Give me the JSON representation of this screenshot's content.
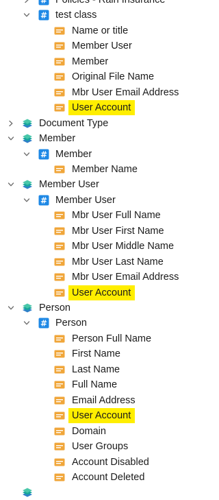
{
  "tree": [
    {
      "label": "Policies - Rain Insurance",
      "icon": "hash-icon",
      "indent": 1,
      "chevron": "right",
      "highlight": false
    },
    {
      "label": "test class",
      "icon": "hash-icon",
      "indent": 1,
      "chevron": "down",
      "highlight": false
    },
    {
      "label": "Name or title",
      "icon": "field-icon",
      "indent": 2,
      "chevron": "none",
      "highlight": false
    },
    {
      "label": "Member User",
      "icon": "field-icon",
      "indent": 2,
      "chevron": "none",
      "highlight": false
    },
    {
      "label": "Member",
      "icon": "field-icon",
      "indent": 2,
      "chevron": "none",
      "highlight": false
    },
    {
      "label": "Original File Name",
      "icon": "field-icon",
      "indent": 2,
      "chevron": "none",
      "highlight": false
    },
    {
      "label": "Mbr User Email Address",
      "icon": "field-icon",
      "indent": 2,
      "chevron": "none",
      "highlight": false
    },
    {
      "label": "User Account",
      "icon": "field-icon",
      "indent": 2,
      "chevron": "none",
      "highlight": true
    },
    {
      "label": "Document Type",
      "icon": "layers-icon",
      "indent": 0,
      "chevron": "right",
      "highlight": false
    },
    {
      "label": "Member",
      "icon": "layers-icon",
      "indent": 0,
      "chevron": "down",
      "highlight": false
    },
    {
      "label": "Member",
      "icon": "hash-icon",
      "indent": 1,
      "chevron": "down",
      "highlight": false
    },
    {
      "label": "Member Name",
      "icon": "field-icon",
      "indent": 2,
      "chevron": "none",
      "highlight": false
    },
    {
      "label": "Member User",
      "icon": "layers-icon",
      "indent": 0,
      "chevron": "down",
      "highlight": false
    },
    {
      "label": "Member User",
      "icon": "hash-icon",
      "indent": 1,
      "chevron": "down",
      "highlight": false
    },
    {
      "label": "Mbr User Full Name",
      "icon": "field-icon",
      "indent": 2,
      "chevron": "none",
      "highlight": false
    },
    {
      "label": "Mbr User First Name",
      "icon": "field-icon",
      "indent": 2,
      "chevron": "none",
      "highlight": false
    },
    {
      "label": "Mbr User Middle Name",
      "icon": "field-icon",
      "indent": 2,
      "chevron": "none",
      "highlight": false
    },
    {
      "label": "Mbr User Last Name",
      "icon": "field-icon",
      "indent": 2,
      "chevron": "none",
      "highlight": false
    },
    {
      "label": "Mbr User Email Address",
      "icon": "field-icon",
      "indent": 2,
      "chevron": "none",
      "highlight": false
    },
    {
      "label": "User Account",
      "icon": "field-icon",
      "indent": 2,
      "chevron": "none",
      "highlight": true
    },
    {
      "label": "Person",
      "icon": "layers-icon",
      "indent": 0,
      "chevron": "down",
      "highlight": false
    },
    {
      "label": "Person",
      "icon": "hash-icon",
      "indent": 1,
      "chevron": "down",
      "highlight": false
    },
    {
      "label": "Person Full Name",
      "icon": "field-icon",
      "indent": 2,
      "chevron": "none",
      "highlight": false
    },
    {
      "label": "First Name",
      "icon": "field-icon",
      "indent": 2,
      "chevron": "none",
      "highlight": false
    },
    {
      "label": "Last Name",
      "icon": "field-icon",
      "indent": 2,
      "chevron": "none",
      "highlight": false
    },
    {
      "label": "Full Name",
      "icon": "field-icon",
      "indent": 2,
      "chevron": "none",
      "highlight": false
    },
    {
      "label": "Email Address",
      "icon": "field-icon",
      "indent": 2,
      "chevron": "none",
      "highlight": false
    },
    {
      "label": "User Account",
      "icon": "field-icon",
      "indent": 2,
      "chevron": "none",
      "highlight": true
    },
    {
      "label": "Domain",
      "icon": "field-icon",
      "indent": 2,
      "chevron": "none",
      "highlight": false
    },
    {
      "label": "User Groups",
      "icon": "field-icon",
      "indent": 2,
      "chevron": "none",
      "highlight": false
    },
    {
      "label": "Account Disabled",
      "icon": "field-icon",
      "indent": 2,
      "chevron": "none",
      "highlight": false
    },
    {
      "label": "Account Deleted",
      "icon": "field-icon",
      "indent": 2,
      "chevron": "none",
      "highlight": false
    },
    {
      "label": "",
      "icon": "layers-icon",
      "indent": 0,
      "chevron": "none",
      "highlight": false
    }
  ],
  "colors": {
    "highlight": "#ffee00",
    "field_icon": "#f0a63a",
    "hash_icon": "#1e88e5",
    "layers_teal": "#17a79a",
    "layers_blue": "#2f80c8",
    "chevron": "#6b6b6b"
  }
}
